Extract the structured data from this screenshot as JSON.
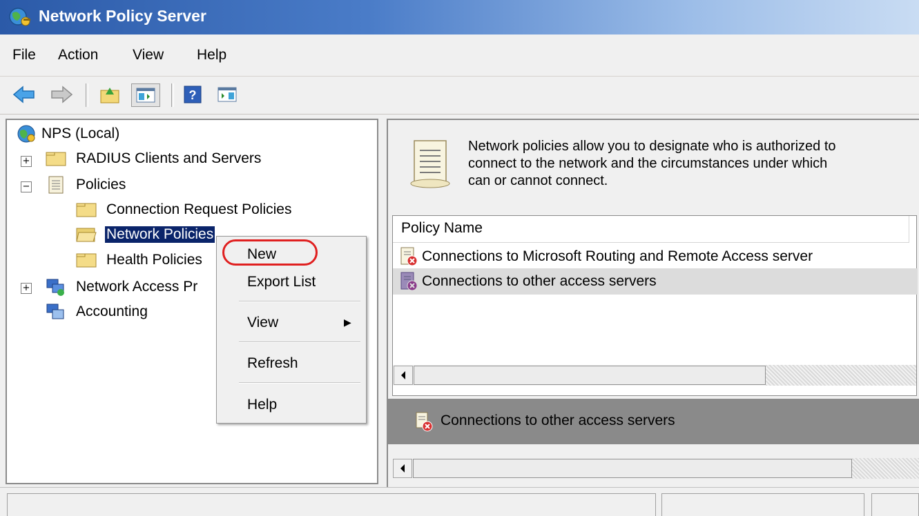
{
  "window": {
    "title": "Network Policy Server"
  },
  "menubar": {
    "items": [
      "File",
      "Action",
      "View",
      "Help"
    ]
  },
  "toolbar": {
    "icons": [
      "back-arrow-icon",
      "forward-arrow-icon",
      "up-folder-icon",
      "show-hide-tree-icon",
      "help-icon",
      "show-hide-action-pane-icon"
    ]
  },
  "tree": {
    "root": "NPS (Local)",
    "radius": "RADIUS Clients and Servers",
    "policies": "Policies",
    "conn_request": "Connection Request Policies",
    "network_policies": "Network Policies",
    "health_policies": "Health Policies",
    "nap": "Network Access Pr",
    "accounting": "Accounting",
    "expand_symbol": "+",
    "collapse_symbol": "−"
  },
  "context_menu": {
    "new": "New",
    "export": "Export List",
    "view": "View",
    "submenu_arrow": "▶",
    "refresh": "Refresh",
    "help": "Help"
  },
  "right_pane": {
    "description_line1": "Network policies allow you to designate who is authorized to",
    "description_line2": "connect to the network and the circumstances under which",
    "description_line3": "can or cannot connect.",
    "column_header": "Policy Name",
    "rows": [
      "Connections to Microsoft Routing and Remote Access server",
      "Connections to other access servers"
    ],
    "detail_title": "Connections to other access servers"
  },
  "colors": {
    "selection": "#0a246a",
    "highlight_circle": "#e02020",
    "title_gradient_start": "#2b5aa8"
  }
}
